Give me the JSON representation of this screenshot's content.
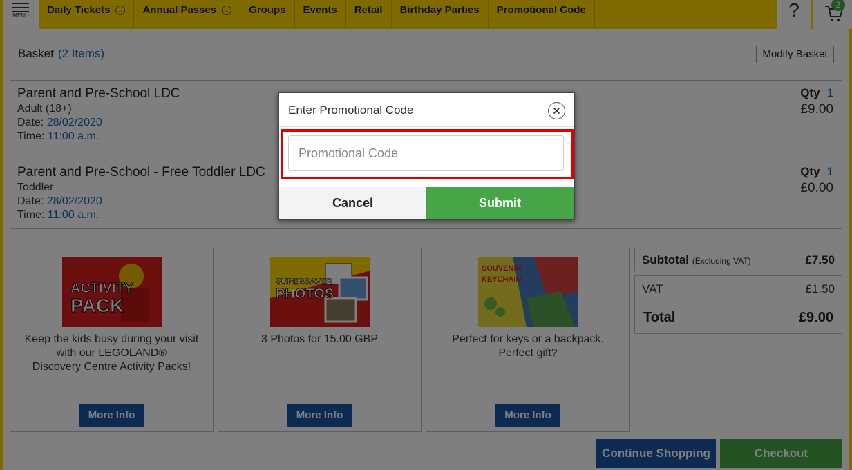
{
  "header": {
    "menu_label": "MENU",
    "nav": [
      {
        "label": "Daily Tickets",
        "has_dropdown": true
      },
      {
        "label": "Annual Passes",
        "has_dropdown": true
      },
      {
        "label": "Groups",
        "has_dropdown": false
      },
      {
        "label": "Events",
        "has_dropdown": false
      },
      {
        "label": "Retail",
        "has_dropdown": false
      },
      {
        "label": "Birthday Parties",
        "has_dropdown": false
      },
      {
        "label": "Promotional Code",
        "has_dropdown": false
      }
    ],
    "help_icon": "question-mark-icon",
    "cart_icon": "cart-icon",
    "cart_count": "2"
  },
  "basket": {
    "title": "Basket",
    "count_label": "(2 Items)",
    "modify_label": "Modify Basket",
    "items": [
      {
        "name": "Parent and Pre-School LDC",
        "ticket_type": "Adult (18+)",
        "date_label": "Date: ",
        "date": "28/02/2020",
        "time_label": "Time: ",
        "time": "11:00 a.m.",
        "qty_label": "Qty",
        "qty": "1",
        "price": "£9.00"
      },
      {
        "name": "Parent and Pre-School - Free Toddler LDC",
        "ticket_type": "Toddler",
        "date_label": "Date: ",
        "date": "28/02/2020",
        "time_label": "Time: ",
        "time": "11:00 a.m.",
        "qty_label": "Qty",
        "qty": "1",
        "price": "£0.00"
      }
    ]
  },
  "upsells": [
    {
      "image_text": [
        "ACTIVITY",
        "PACK"
      ],
      "description": [
        "Keep the kids busy during your visit",
        "with our LEGOLAND®",
        "Discovery Centre Activity Packs!"
      ],
      "button": "More Info"
    },
    {
      "image_text": [
        "SUPERSAVER",
        "PHOTOS"
      ],
      "description": [
        "3 Photos for 15.00 GBP"
      ],
      "button": "More Info"
    },
    {
      "image_text": [
        "SOUVENIR",
        "KEYCHAIN"
      ],
      "description": [
        "Perfect for keys or a backpack.",
        "Perfect gift?"
      ],
      "button": "More Info"
    }
  ],
  "summary": {
    "subtotal_label": "Subtotal",
    "subtotal_note": "(Excluding VAT)",
    "subtotal": "£7.50",
    "vat_label": "VAT",
    "vat": "£1.50",
    "total_label": "Total",
    "total": "£9.00"
  },
  "actions": {
    "continue_label": "Continue Shopping",
    "checkout_label": "Checkout"
  },
  "modal": {
    "title": "Enter Promotional Code",
    "close_icon": "close-icon",
    "input_placeholder": "Promotional Code",
    "input_value": "",
    "cancel_label": "Cancel",
    "submit_label": "Submit"
  },
  "colors": {
    "brand_yellow": "#ffd500",
    "link_blue": "#1a5fb4",
    "button_blue": "#1a55a6",
    "button_green": "#46a546",
    "highlight_red": "#e00000"
  }
}
